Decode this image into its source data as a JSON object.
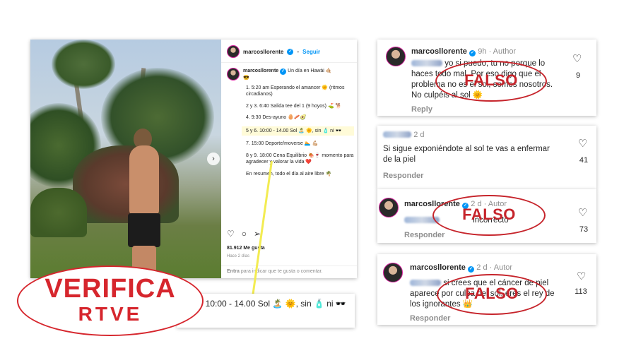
{
  "post": {
    "username": "marcosllorente",
    "follow_label": "Seguir",
    "caption_title": "Un día en Hawái 🤙🏼",
    "caption_emoji": "😎",
    "caption_lines": [
      "1. 5:20 am Esperando el amancer 🌞 (ritmos circadianos)",
      "2 y 3. 6:40 Salida tee del 1 (9 hoyos) ⛳ 🐕",
      "4. 9:30 Des-ayuno 🥚🥓🥑",
      "5 y 6. 10:00 - 14.00 Sol 🏝️ 🌞, sin 🧴 ni 🕶️",
      "7. 15:00 Deporte/moverse 🏊 💪🏼",
      "8 y 9. 18:00 Cena Equilibrio 🍖🍷 momento para agradecer y valorar la vida ❤️",
      "En resumen, todo el día al aire libre 🌴"
    ],
    "actions": [
      "♡",
      "○",
      "➢"
    ],
    "likes": "81.912 Me gusta",
    "date": "Hace 2 días",
    "comment_hint_strong": "Entra",
    "comment_hint_rest": " para indicar que te gusta o comentar."
  },
  "zoom": {
    "text": "5 y 6. 10:00 - 14.00 Sol 🏝️ 🌞, sin 🧴 ni 🕶️"
  },
  "comments": [
    {
      "name": "marcosllorente",
      "meta": "9h · Author",
      "text": "yo si puedo, tu no porque lo haces todo mal. Por eso digo que el problema no es el sol, somos nosotros. No culpéis al sol 🌞",
      "reply": "Reply",
      "likes": "9",
      "stamp": "FALSO"
    },
    {
      "name": "",
      "meta": "2 d",
      "text": "Si sigue exponiéndote al sol te vas a enfermar de la piel",
      "reply": "Responder",
      "likes": "41",
      "stamp": ""
    },
    {
      "name": "marcosllorente",
      "meta": "2 d · Autor",
      "text": "incorrecto",
      "reply": "Responder",
      "likes": "73",
      "stamp": "FALSO"
    },
    {
      "name": "marcosllorente",
      "meta": "2 d · Autor",
      "text": "si crees que el cáncer de piel aparece por culpa del sol, eres el rey de los ignorantes 👑",
      "reply": "Responder",
      "likes": "113",
      "stamp": "FALSO"
    }
  ],
  "logo": {
    "word": "VERIFICA",
    "brand": "RTVE"
  }
}
